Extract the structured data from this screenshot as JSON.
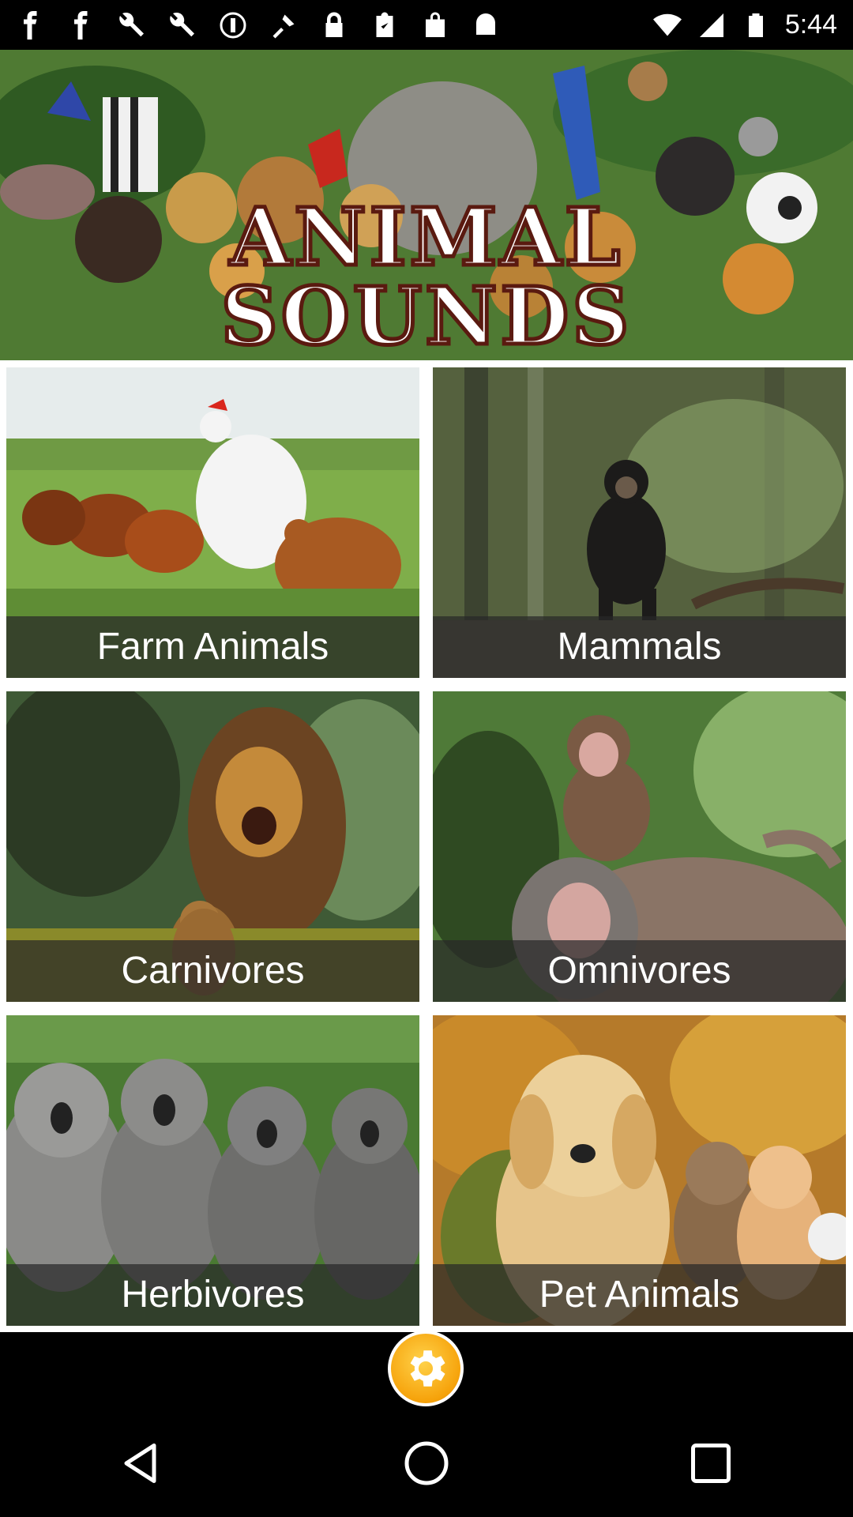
{
  "status_bar": {
    "time": "5:44",
    "icons": [
      "facebook-icon",
      "facebook-icon",
      "wrench-icon",
      "wrench-icon",
      "copyright-icon",
      "fake-gps-icon",
      "lock-icon",
      "clipboard-icon",
      "bag-icon",
      "android-icon"
    ]
  },
  "banner": {
    "title": "ANIMAL SOUNDS"
  },
  "categories": [
    {
      "label": "Farm Animals"
    },
    {
      "label": "Mammals"
    },
    {
      "label": "Carnivores"
    },
    {
      "label": "Omnivores"
    },
    {
      "label": "Herbivores"
    },
    {
      "label": "Pet Animals"
    }
  ],
  "settings": {
    "icon": "gear-icon",
    "accent": "#f6a20a"
  },
  "navigation": {
    "back": "back-icon",
    "home": "home-icon",
    "recents": "recents-icon"
  }
}
